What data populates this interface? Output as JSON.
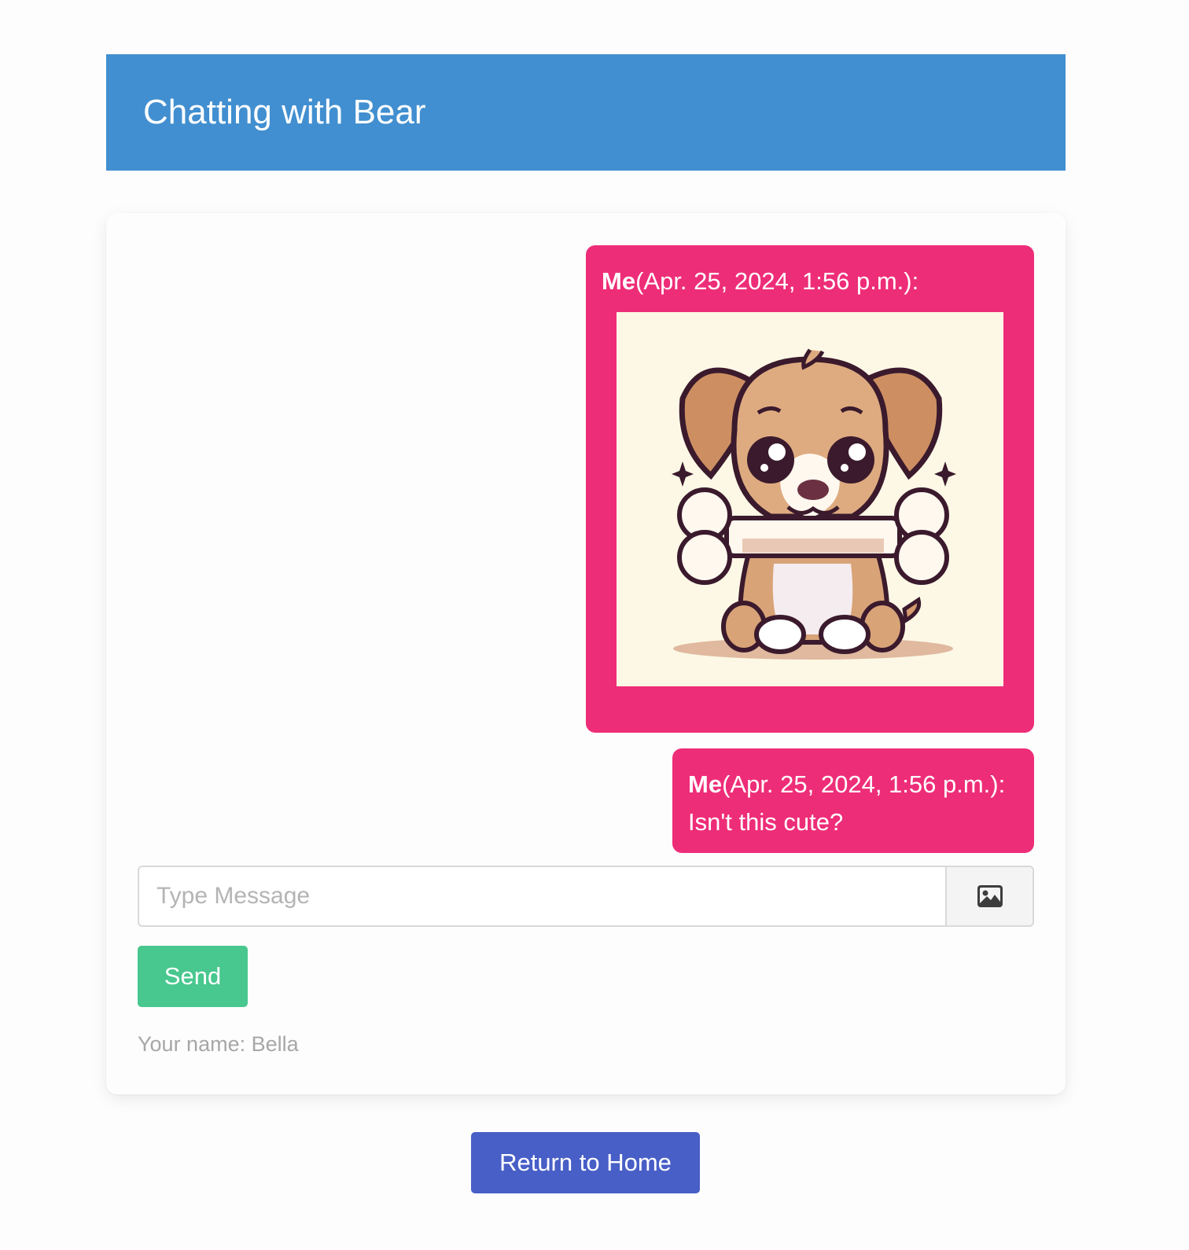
{
  "header": {
    "title": "Chatting with Bear"
  },
  "messages": [
    {
      "sender": "Me",
      "timestamp": "(Apr. 25, 2024, 1:56 p.m.):",
      "type": "image",
      "image_description": "cartoon puppy holding a bone"
    },
    {
      "sender": "Me",
      "timestamp": "(Apr. 25, 2024, 1:56 p.m.):",
      "type": "text",
      "text": "Isn't this cute?"
    }
  ],
  "composer": {
    "placeholder": "Type Message",
    "value": "",
    "image_button_icon": "image-icon",
    "send_label": "Send"
  },
  "user": {
    "name_label": "Your name: Bella"
  },
  "footer": {
    "home_label": "Return to Home"
  },
  "colors": {
    "header": "#418fd0",
    "bubble": "#ee2d78",
    "send_button": "#48c78e",
    "home_button": "#485fc7"
  }
}
